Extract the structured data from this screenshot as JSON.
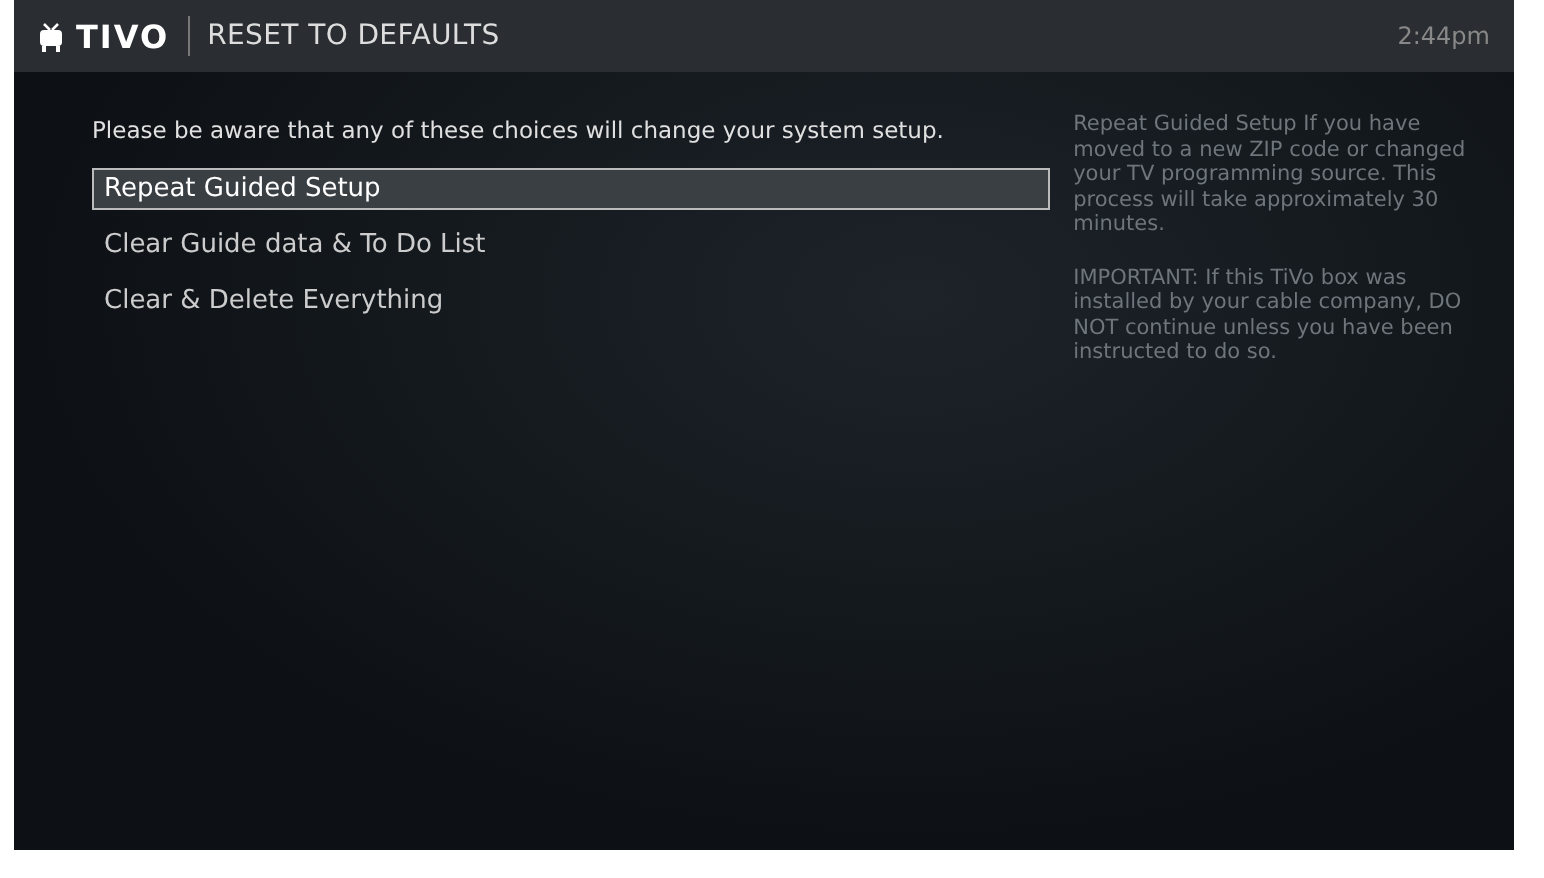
{
  "header": {
    "logo": "TIVO",
    "title": "RESET TO DEFAULTS",
    "time": "2:44pm"
  },
  "intro": "Please be aware that any of these choices will change your system setup.",
  "menu": [
    {
      "label": "Repeat Guided Setup",
      "selected": true
    },
    {
      "label": "Clear Guide data & To Do List",
      "selected": false
    },
    {
      "label": "Clear & Delete Everything",
      "selected": false
    }
  ],
  "help": [
    "Repeat Guided Setup If you have moved to a new ZIP code or changed your TV programming source. This process will take approximately 30 minutes.",
    "IMPORTANT: If this TiVo box was installed by your cable company, DO NOT continue unless you have been instructed to do so."
  ]
}
